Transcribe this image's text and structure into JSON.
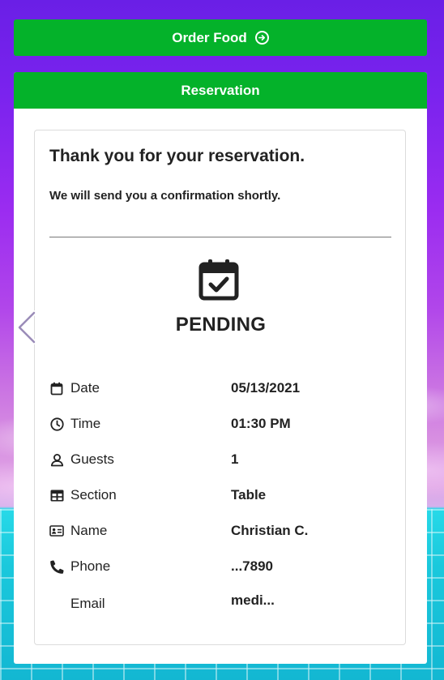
{
  "order_button": {
    "label": "Order Food",
    "icon": "arrow-circle-right-icon"
  },
  "panel": {
    "header": "Reservation"
  },
  "confirmation": {
    "title": "Thank you for your reservation.",
    "subtitle": "We will send you a confirmation shortly.",
    "status_icon": "calendar-check-icon",
    "status": "PENDING"
  },
  "details": [
    {
      "icon": "calendar-icon",
      "label": "Date",
      "value": "05/13/2021"
    },
    {
      "icon": "clock-icon",
      "label": "Time",
      "value": "01:30 PM"
    },
    {
      "icon": "user-icon",
      "label": "Guests",
      "value": "1"
    },
    {
      "icon": "table-icon",
      "label": "Section",
      "value": "Table"
    },
    {
      "icon": "id-card-icon",
      "label": "Name",
      "value": "Christian C."
    },
    {
      "icon": "phone-icon",
      "label": "Phone",
      "value": "...7890"
    },
    {
      "icon": "",
      "label": "Email",
      "value": "medi..."
    }
  ],
  "carousel": {
    "prev_icon": "chevron-left-icon"
  },
  "colors": {
    "accent": "#04b22a",
    "text": "#222222",
    "card_border": "#dcdcdc"
  }
}
